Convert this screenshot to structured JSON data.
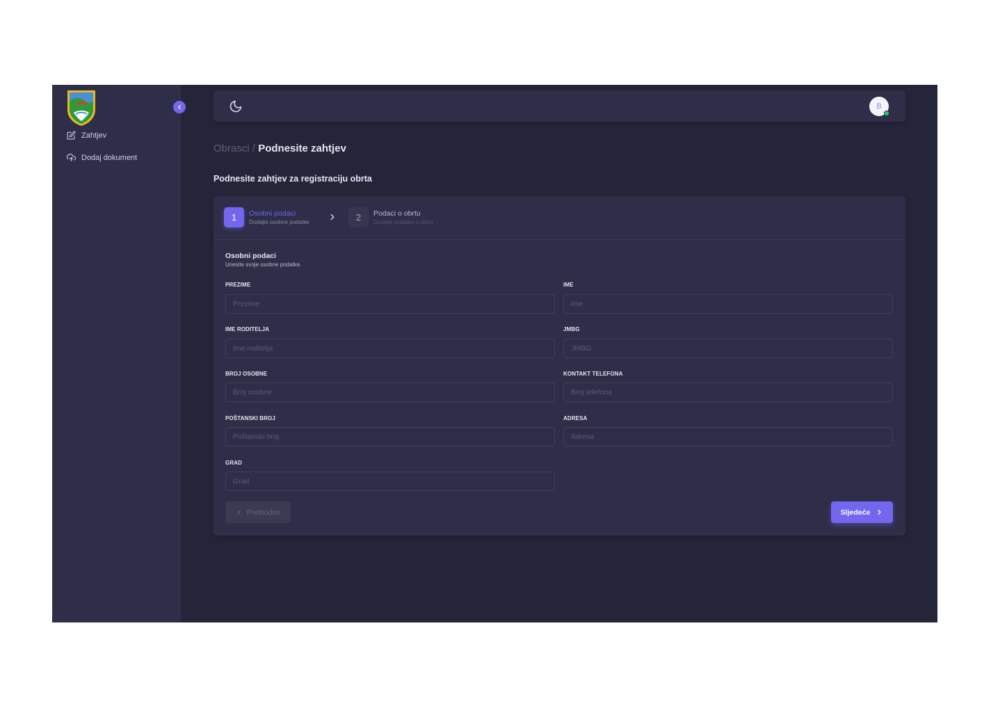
{
  "sidebar": {
    "logo": "municipality-coat-of-arms",
    "items": [
      {
        "label": "Zahtjev",
        "icon": "edit-icon"
      },
      {
        "label": "Dodaj dokument",
        "icon": "cloud-upload-icon"
      }
    ]
  },
  "topbar": {
    "avatar_initial": "B",
    "avatar_status": "online"
  },
  "breadcrumb": {
    "parent": "Obrasci",
    "separator": "/",
    "current": "Podnesite zahtjev"
  },
  "page": {
    "subtitle": "Podnesite zahtjev za registraciju obrta"
  },
  "stepper": {
    "steps": [
      {
        "number": "1",
        "title": "Osobni podaci",
        "subtitle": "Dodajte osobne podatke",
        "active": true
      },
      {
        "number": "2",
        "title": "Podaci o obrtu",
        "subtitle": "Dodajte podatke o obrtu",
        "active": false
      }
    ]
  },
  "form": {
    "section_title": "Osobni podaci",
    "section_desc": "Unesite svoje osobne podatke.",
    "fields": {
      "prezime": {
        "label": "PREZIME",
        "placeholder": "Prezime"
      },
      "ime": {
        "label": "IME",
        "placeholder": "Ime"
      },
      "ime_roditelja": {
        "label": "IME RODITELJA",
        "placeholder": "Ime roditelja"
      },
      "jmbg": {
        "label": "JMBG",
        "placeholder": "JMBG"
      },
      "broj_osobne": {
        "label": "BROJ OSOBNE",
        "placeholder": "Broj osobne"
      },
      "kontakt_telefona": {
        "label": "KONTAKT TELEFONA",
        "placeholder": "Broj telefona"
      },
      "postanski_broj": {
        "label": "POŠTANSKI BROJ",
        "placeholder": "Poštanski broj"
      },
      "adresa": {
        "label": "ADRESA",
        "placeholder": "Adresa"
      },
      "grad": {
        "label": "GRAD",
        "placeholder": "Grad"
      }
    },
    "prev_label": "Prethodno",
    "next_label": "Sljedeće"
  },
  "colors": {
    "primary": "#7367f0",
    "background": "#25253a",
    "surface": "#2e2e48",
    "status_online": "#28c76f"
  }
}
